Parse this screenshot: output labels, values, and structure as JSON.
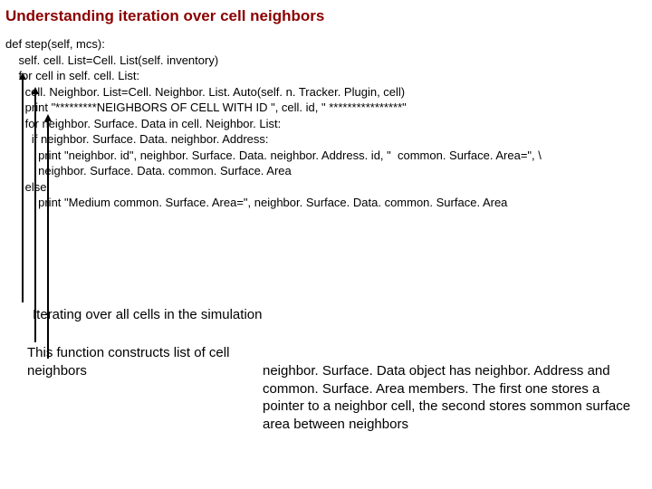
{
  "title": "Understanding iteration over cell neighbors",
  "code": {
    "l0": "def step(self, mcs):",
    "l1": "    self. cell. List=Cell. List(self. inventory)",
    "l2": "    for cell in self. cell. List:",
    "l3": "      cell. Neighbor. List=Cell. Neighbor. List. Auto(self. n. Tracker. Plugin, cell)",
    "l4": "      print \"*********NEIGHBORS OF CELL WITH ID \", cell. id, \" ****************\"",
    "l5": "      for neighbor. Surface. Data in cell. Neighbor. List:",
    "l6": "        if neighbor. Surface. Data. neighbor. Address:",
    "l7": "          print \"neighbor. id\", neighbor. Surface. Data. neighbor. Address. id, \"  common. Surface. Area=\", \\",
    "l8": "          neighbor. Surface. Data. common. Surface. Area",
    "l9": "      else:",
    "l10": "          print \"Medium common. Surface. Area=\", neighbor. Surface. Data. common. Surface. Area"
  },
  "annotations": {
    "a1": "Iterating over all cells in the simulation",
    "a2": "This function constructs list of cell neighbors",
    "a3": "neighbor. Surface. Data object has neighbor. Address and common. Surface. Area members. The first one stores a pointer to a neighbor cell, the second stores sommon surface area between neighbors"
  }
}
